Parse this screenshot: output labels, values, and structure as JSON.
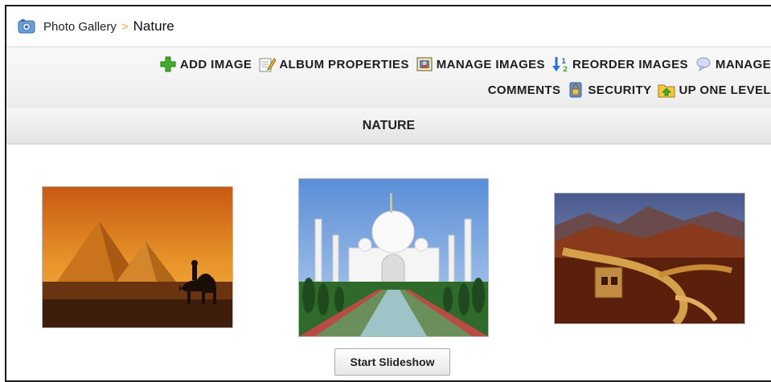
{
  "breadcrumb": {
    "icon": "photo-gallery-icon",
    "parent": "Photo Gallery",
    "separator": ">",
    "current": "Nature"
  },
  "toolbar": {
    "items": [
      {
        "label": "ADD IMAGE",
        "icon": "add-icon"
      },
      {
        "label": "ALBUM PROPERTIES",
        "icon": "edit-properties-icon"
      },
      {
        "label": "MANAGE IMAGES",
        "icon": "manage-images-icon"
      },
      {
        "label": "REORDER IMAGES",
        "icon": "reorder-icon"
      },
      {
        "label": "MANAGE",
        "icon": "comments-icon"
      },
      {
        "label": "COMMENTS"
      },
      {
        "label": "SECURITY",
        "icon": "security-icon"
      },
      {
        "label": "UP ONE LEVEL",
        "icon": "up-folder-icon"
      }
    ]
  },
  "section": {
    "title": "NATURE"
  },
  "gallery": {
    "images": [
      {
        "subject": "pyramids"
      },
      {
        "subject": "taj-mahal"
      },
      {
        "subject": "great-wall"
      }
    ],
    "slideshow_label": "Start Slideshow"
  },
  "colors": {
    "accent_add": "#3fae2a",
    "breadcrumb_separator": "#f0a23c",
    "toolbar_bg": "#ececec",
    "frame_border": "#1a1a1a"
  }
}
